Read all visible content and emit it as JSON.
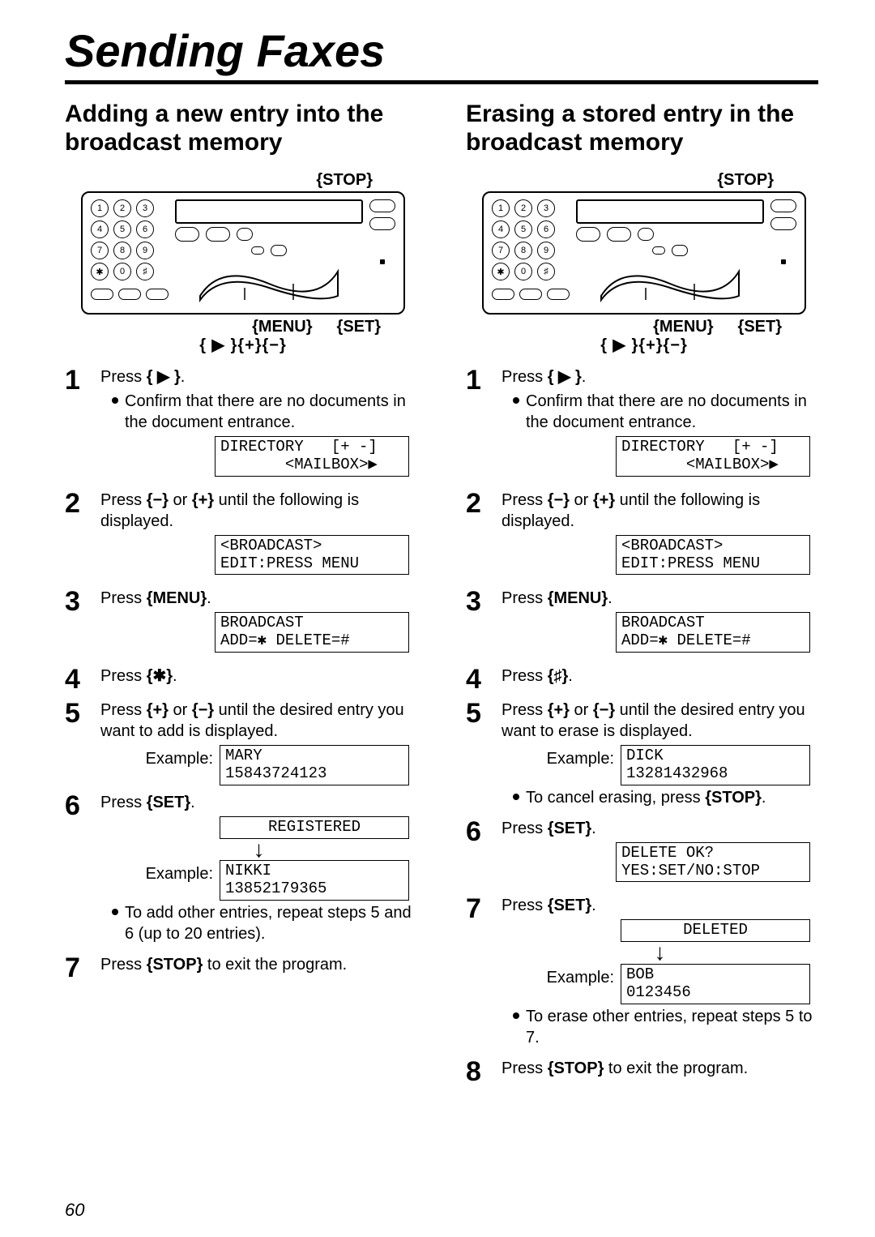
{
  "title": "Sending Faxes",
  "pageNumber": "60",
  "labels": {
    "stop": "{STOP}",
    "menu": "{MENU}",
    "set": "{SET}",
    "nav": "{ ▶ }{+}{−}",
    "example": "Example:"
  },
  "keypad": [
    [
      "1",
      "2",
      "3"
    ],
    [
      "4",
      "5",
      "6"
    ],
    [
      "7",
      "8",
      "9"
    ],
    [
      "✱",
      "0",
      "♯"
    ]
  ],
  "left": {
    "subtitle": "Adding a new entry into the broadcast memory",
    "steps": {
      "s1": {
        "text_a": "Press ",
        "key1": "{ ▶ }",
        "text_b": ".",
        "bullet": "Confirm that there are no documents in the document entrance.",
        "lcd": "DIRECTORY   [+ -]\n       <MAILBOX>▶"
      },
      "s2": {
        "text_a": "Press ",
        "key1": "{−}",
        "text_mid": " or ",
        "key2": "{+}",
        "text_b": " until the following is displayed.",
        "lcd": "<BROADCAST>\nEDIT:PRESS MENU"
      },
      "s3": {
        "text_a": "Press ",
        "key1": "{MENU}",
        "text_b": ".",
        "lcd": "BROADCAST\nADD=✱ DELETE=#"
      },
      "s4": {
        "text_a": "Press ",
        "key1": "{✱}",
        "text_b": "."
      },
      "s5": {
        "text_a": "Press ",
        "key1": "{+}",
        "text_mid": " or ",
        "key2": "{−}",
        "text_b": " until the desired entry you want to add is displayed.",
        "lcd": "MARY\n15843724123"
      },
      "s6": {
        "text_a": "Press ",
        "key1": "{SET}",
        "text_b": ".",
        "lcd1": "REGISTERED",
        "lcd2": "NIKKI\n13852179365",
        "bullet": "To add other entries, repeat steps 5 and 6 (up to 20 entries)."
      },
      "s7": {
        "text_a": "Press ",
        "key1": "{STOP}",
        "text_b": " to exit the program."
      }
    }
  },
  "right": {
    "subtitle": "Erasing a stored entry in the broadcast memory",
    "steps": {
      "s1": {
        "text_a": "Press ",
        "key1": "{ ▶ }",
        "text_b": ".",
        "bullet": "Confirm that there are no documents in the document entrance.",
        "lcd": "DIRECTORY   [+ -]\n       <MAILBOX>▶"
      },
      "s2": {
        "text_a": "Press ",
        "key1": "{−}",
        "text_mid": " or ",
        "key2": "{+}",
        "text_b": " until the following is displayed.",
        "lcd": "<BROADCAST>\nEDIT:PRESS MENU"
      },
      "s3": {
        "text_a": "Press ",
        "key1": "{MENU}",
        "text_b": ".",
        "lcd": "BROADCAST\nADD=✱ DELETE=#"
      },
      "s4": {
        "text_a": "Press ",
        "key1": "{♯}",
        "text_b": "."
      },
      "s5": {
        "text_a": "Press ",
        "key1": "{+}",
        "text_mid": " or ",
        "key2": "{−}",
        "text_b": " until the desired entry you want to erase is displayed.",
        "lcd": "DICK\n13281432968",
        "bullet": "To cancel erasing, press ",
        "bullet_key": "{STOP}",
        "bullet_tail": "."
      },
      "s6": {
        "text_a": "Press ",
        "key1": "{SET}",
        "text_b": ".",
        "lcd": "DELETE OK?\nYES:SET/NO:STOP"
      },
      "s7": {
        "text_a": "Press ",
        "key1": "{SET}",
        "text_b": ".",
        "lcd1": "DELETED",
        "lcd2": "BOB\n0123456",
        "bullet": "To erase other entries, repeat steps 5 to 7."
      },
      "s8": {
        "text_a": "Press ",
        "key1": "{STOP}",
        "text_b": " to exit the program."
      }
    }
  }
}
